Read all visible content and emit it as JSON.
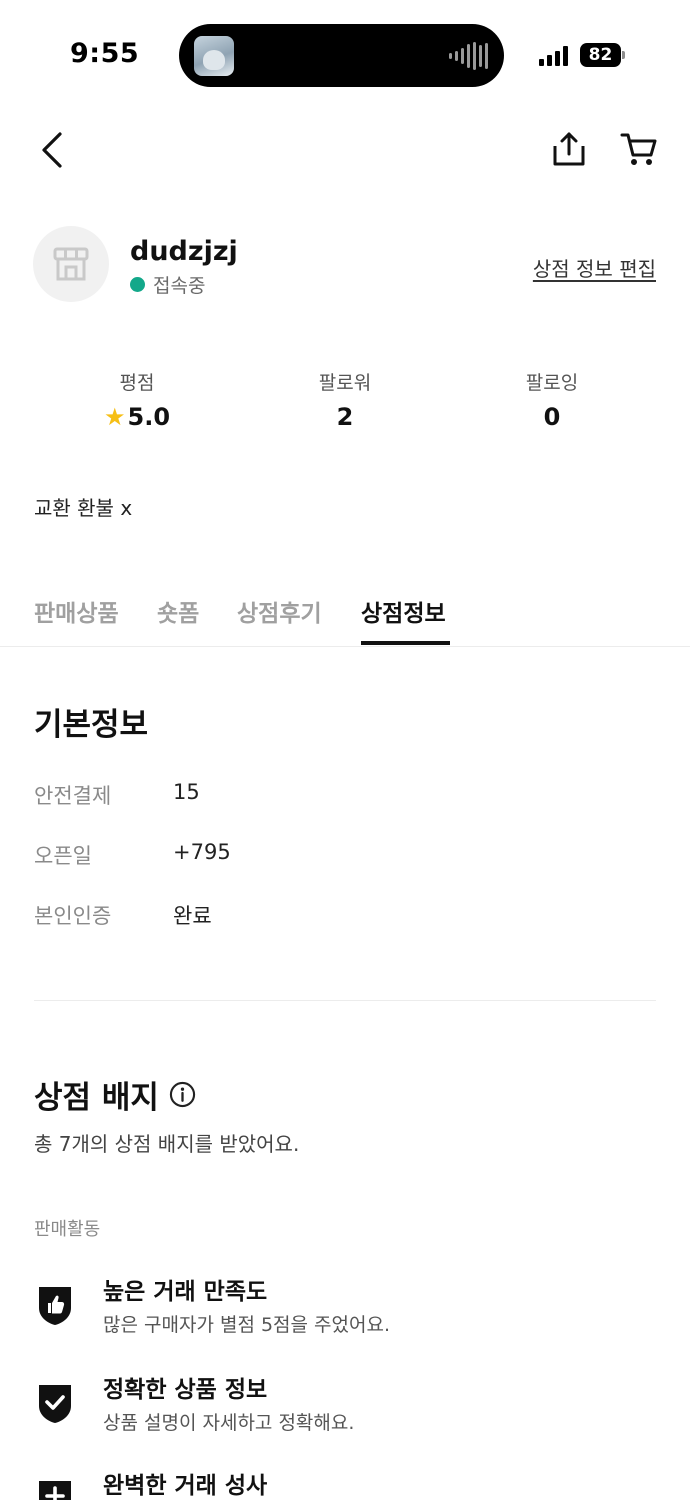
{
  "status_bar": {
    "time": "9:55",
    "battery": "82"
  },
  "shop": {
    "name": "dudzjzj",
    "status": "접속중",
    "edit_label": "상점 정보 편집"
  },
  "stats": [
    {
      "label": "평점",
      "value": "5.0"
    },
    {
      "label": "팔로워",
      "value": "2"
    },
    {
      "label": "팔로잉",
      "value": "0"
    }
  ],
  "intro": "교환 환불 x",
  "tabs": [
    {
      "label": "판매상품"
    },
    {
      "label": "숏폼"
    },
    {
      "label": "상점후기"
    },
    {
      "label": "상점정보"
    }
  ],
  "active_tab": "상점정보",
  "basic_info": {
    "title": "기본정보",
    "rows": [
      {
        "key": "안전결제",
        "value": "15"
      },
      {
        "key": "오픈일",
        "value": "+795"
      },
      {
        "key": "본인인증",
        "value": "완료"
      }
    ]
  },
  "badges": {
    "title": "상점 배지",
    "subtitle": "총 7개의 상점 배지를 받았어요.",
    "category": "판매활동",
    "items": [
      {
        "name": "높은 거래 만족도",
        "desc": "많은 구매자가 별점 5점을 주었어요.",
        "icon": "thumb-up-icon"
      },
      {
        "name": "정확한 상품 정보",
        "desc": "상품 설명이 자세하고 정확해요.",
        "icon": "checkmark-icon"
      },
      {
        "name": "완벽한 거래 성사",
        "desc": "",
        "icon": "plus-icon"
      }
    ]
  },
  "colors": {
    "online": "#13a88a",
    "star": "#f6bf16",
    "text": "#111111",
    "muted": "#8a8a8a"
  }
}
